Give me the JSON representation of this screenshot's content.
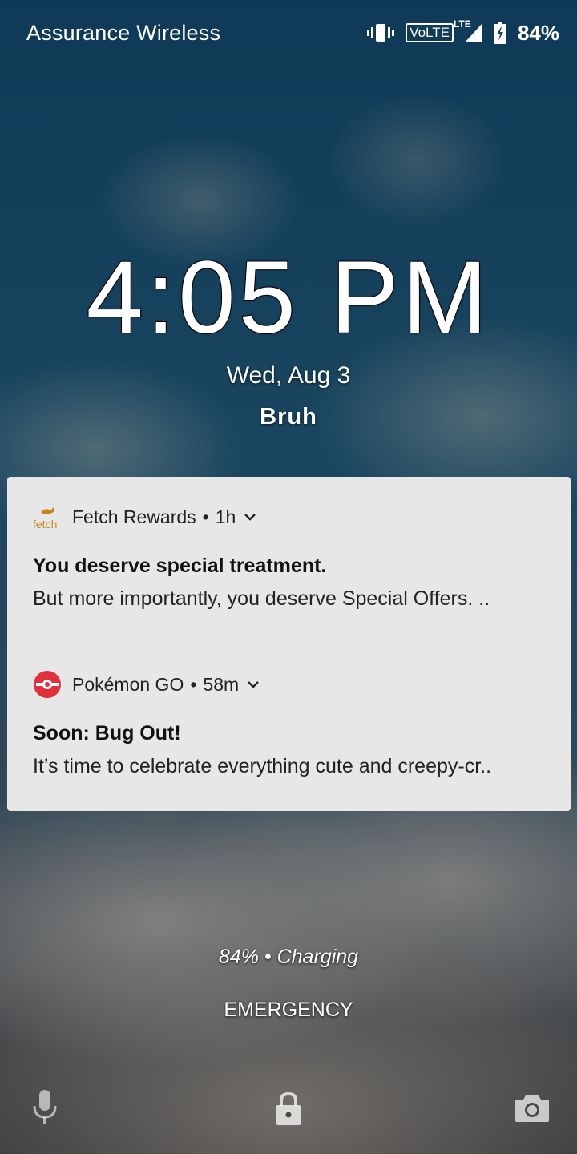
{
  "status_bar": {
    "carrier": "Assurance Wireless",
    "icons": [
      "vibrate-icon",
      "volte-icon",
      "lte-signal-icon",
      "battery-charging-icon"
    ],
    "volte_label": "VoLTE",
    "lte_label": "LTE",
    "battery_percent": "84%"
  },
  "lock_screen": {
    "time": "4:05 PM",
    "date": "Wed, Aug 3",
    "owner_info": "Bruh"
  },
  "notifications": [
    {
      "app_name": "Fetch Rewards",
      "time": "1h",
      "icon": "fetch-rewards-icon",
      "icon_text": "fetch",
      "accent_color": "#b8860b",
      "title": "You deserve special treatment.",
      "body": "But more importantly, you deserve Special Offers. .."
    },
    {
      "app_name": "Pokémon GO",
      "time": "58m",
      "icon": "pokeball-icon",
      "accent_color": "#e0313c",
      "title": "Soon: Bug Out!",
      "body": "It’s time to celebrate everything cute and creepy-cr.."
    }
  ],
  "separator": "•",
  "charging_status": "84% • Charging",
  "emergency_label": "EMERGENCY",
  "bottom_shortcuts": [
    "microphone-icon",
    "lock-icon",
    "camera-icon"
  ]
}
